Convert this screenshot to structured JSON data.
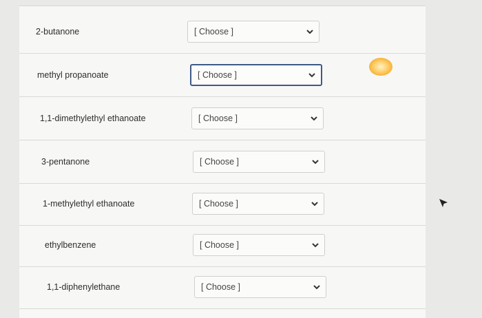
{
  "form": {
    "rows": [
      {
        "label": "2-butanone",
        "selected": "[ Choose ]"
      },
      {
        "label": "methyl propanoate",
        "selected": "[ Choose ]"
      },
      {
        "label": "1,1-dimethylethyl ethanoate",
        "selected": "[ Choose ]"
      },
      {
        "label": "3-pentanone",
        "selected": "[ Choose ]"
      },
      {
        "label": "1-methylethyl ethanoate",
        "selected": "[ Choose ]"
      },
      {
        "label": "ethylbenzene",
        "selected": "[ Choose ]"
      },
      {
        "label": "1,1-diphenylethane",
        "selected": "[ Choose ]"
      }
    ],
    "focused_row": 1
  },
  "icons": {
    "dropdown": "chevron-down-icon",
    "cursor": "mouse-pointer-icon"
  },
  "colors": {
    "focus_border": "#3d5a86",
    "glare": "#f7b43a"
  }
}
